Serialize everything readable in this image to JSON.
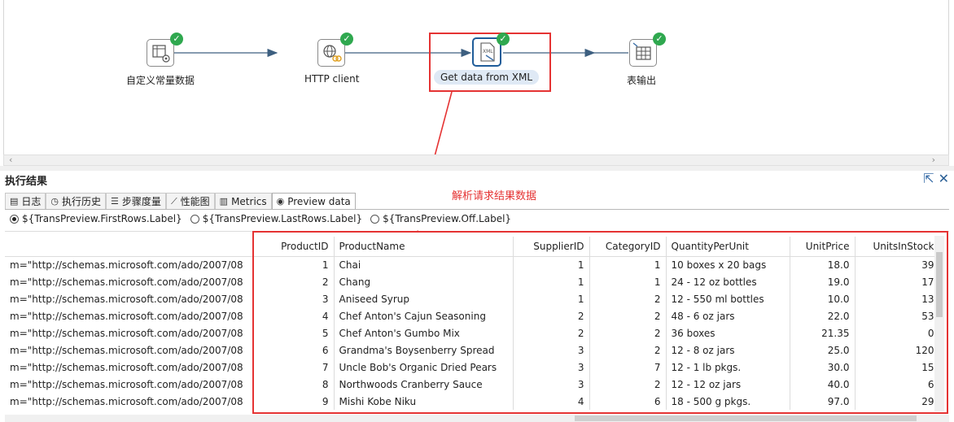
{
  "flow": {
    "steps": [
      {
        "id": "s1",
        "label": "自定义常量数据",
        "icon": "table-gear-icon",
        "status": "ok"
      },
      {
        "id": "s2",
        "label": "HTTP client",
        "icon": "http-globe-icon",
        "status": "ok"
      },
      {
        "id": "s3",
        "label": "Get data from XML",
        "icon": "xml-file-icon",
        "status": "ok"
      },
      {
        "id": "s4",
        "label": "表输出",
        "icon": "table-output-icon",
        "status": "ok"
      }
    ],
    "check_glyph": "✓"
  },
  "annotation": "解析请求结果数据",
  "panel": {
    "title": "执行结果",
    "tabs": [
      {
        "label": "日志",
        "icon": "log-icon"
      },
      {
        "label": "执行历史",
        "icon": "history-icon"
      },
      {
        "label": "步骤度量",
        "icon": "step-metrics-icon"
      },
      {
        "label": "性能图",
        "icon": "performance-icon"
      },
      {
        "label": "Metrics",
        "icon": "metrics-icon"
      },
      {
        "label": "Preview data",
        "icon": "eye-icon"
      }
    ],
    "radios": [
      {
        "label": "${TransPreview.FirstRows.Label}",
        "checked": true
      },
      {
        "label": "${TransPreview.LastRows.Label}",
        "checked": false
      },
      {
        "label": "${TransPreview.Off.Label}",
        "checked": false
      }
    ]
  },
  "grid": {
    "columns": [
      "",
      "ProductID",
      "ProductName",
      "SupplierID",
      "CategoryID",
      "QuantityPerUnit",
      "UnitPrice",
      "UnitsInStock"
    ],
    "rows": [
      [
        "m=\"http://schemas.microsoft.com/ado/2007/08",
        "1",
        "Chai",
        "1",
        "1",
        "10 boxes x 20 bags",
        "18.0",
        "39"
      ],
      [
        "m=\"http://schemas.microsoft.com/ado/2007/08",
        "2",
        "Chang",
        "1",
        "1",
        "24 - 12 oz bottles",
        "19.0",
        "17"
      ],
      [
        "m=\"http://schemas.microsoft.com/ado/2007/08",
        "3",
        "Aniseed Syrup",
        "1",
        "2",
        "12 - 550 ml bottles",
        "10.0",
        "13"
      ],
      [
        "m=\"http://schemas.microsoft.com/ado/2007/08",
        "4",
        "Chef Anton's Cajun Seasoning",
        "2",
        "2",
        "48 - 6 oz jars",
        "22.0",
        "53"
      ],
      [
        "m=\"http://schemas.microsoft.com/ado/2007/08",
        "5",
        "Chef Anton's Gumbo Mix",
        "2",
        "2",
        "36 boxes",
        "21.35",
        "0"
      ],
      [
        "m=\"http://schemas.microsoft.com/ado/2007/08",
        "6",
        "Grandma's Boysenberry Spread",
        "3",
        "2",
        "12 - 8 oz jars",
        "25.0",
        "120"
      ],
      [
        "m=\"http://schemas.microsoft.com/ado/2007/08",
        "7",
        "Uncle Bob's Organic Dried Pears",
        "3",
        "7",
        "12 - 1 lb pkgs.",
        "30.0",
        "15"
      ],
      [
        "m=\"http://schemas.microsoft.com/ado/2007/08",
        "8",
        "Northwoods Cranberry Sauce",
        "3",
        "2",
        "12 - 12 oz jars",
        "40.0",
        "6"
      ],
      [
        "m=\"http://schemas.microsoft.com/ado/2007/08",
        "9",
        "Mishi Kobe Niku",
        "4",
        "6",
        "18 - 500 g pkgs.",
        "97.0",
        "29"
      ]
    ]
  },
  "colors": {
    "highlight": "#e53333",
    "ok": "#2fa84f",
    "selected": "#1f5c99"
  }
}
